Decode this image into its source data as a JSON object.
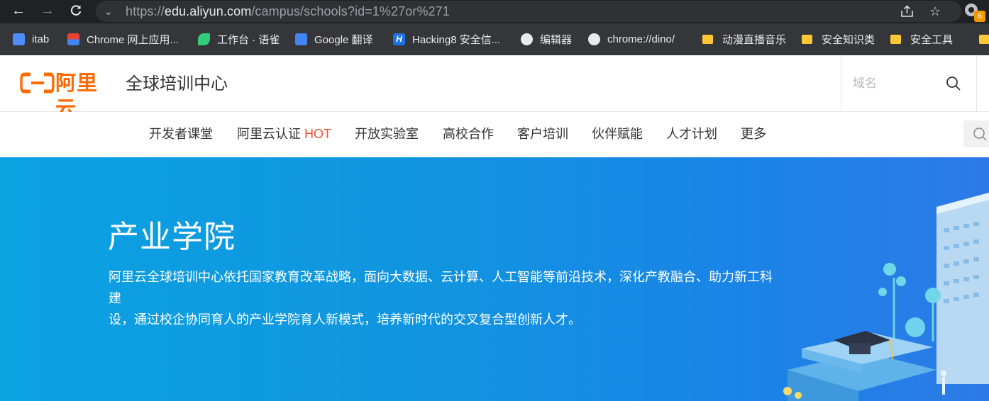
{
  "browser": {
    "url_scheme": "https://",
    "url_domain": "edu.aliyun.com",
    "url_path": "/campus/schools?id=1%27or%271",
    "extension_badge": "6"
  },
  "bookmarks": [
    {
      "label": "itab",
      "icon": "itab-icon",
      "color": "#4f8cff"
    },
    {
      "label": "Chrome 网上应用...",
      "icon": "chrome-store-icon",
      "color": "#e94235"
    },
    {
      "label": "工作台 · 语雀",
      "icon": "yuque-icon",
      "color": "#31cc79"
    },
    {
      "label": "Google 翻译",
      "icon": "google-translate-icon",
      "color": "#4285f4"
    },
    {
      "label": "Hacking8 安全信...",
      "icon": "hacking8-icon",
      "color": "#1a73e8"
    },
    {
      "label": "编辑器",
      "icon": "globe-icon",
      "color": "#e8eaed"
    },
    {
      "label": "chrome://dino/",
      "icon": "globe-icon",
      "color": "#e8eaed"
    },
    {
      "label": "动漫直播音乐",
      "icon": "folder-icon",
      "color": "#fcc934"
    },
    {
      "label": "安全知识类",
      "icon": "folder-icon",
      "color": "#fcc934"
    },
    {
      "label": "安全工具",
      "icon": "folder-icon",
      "color": "#fcc934"
    }
  ],
  "header": {
    "logo_text": "阿里云",
    "site_title": "全球培训中心",
    "search_placeholder": "域名",
    "brand_color": "#ff6a00"
  },
  "nav": {
    "items": [
      {
        "label": "开发者课堂"
      },
      {
        "label": "阿里云认证",
        "badge": "HOT"
      },
      {
        "label": "开放实验室"
      },
      {
        "label": "高校合作"
      },
      {
        "label": "客户培训"
      },
      {
        "label": "伙伴赋能"
      },
      {
        "label": "人才计划"
      },
      {
        "label": "更多"
      }
    ]
  },
  "hero": {
    "title": "产业学院",
    "desc_line1": "阿里云全球培训中心依托国家教育改革战略，面向大数据、云计算、人工智能等前沿技术，深化产教融合、助力新工科建",
    "desc_line2": "设，通过校企协同育人的产业学院育人新模式，培养新时代的交叉复合型创新人才。",
    "bg_color": "#1194e0"
  }
}
